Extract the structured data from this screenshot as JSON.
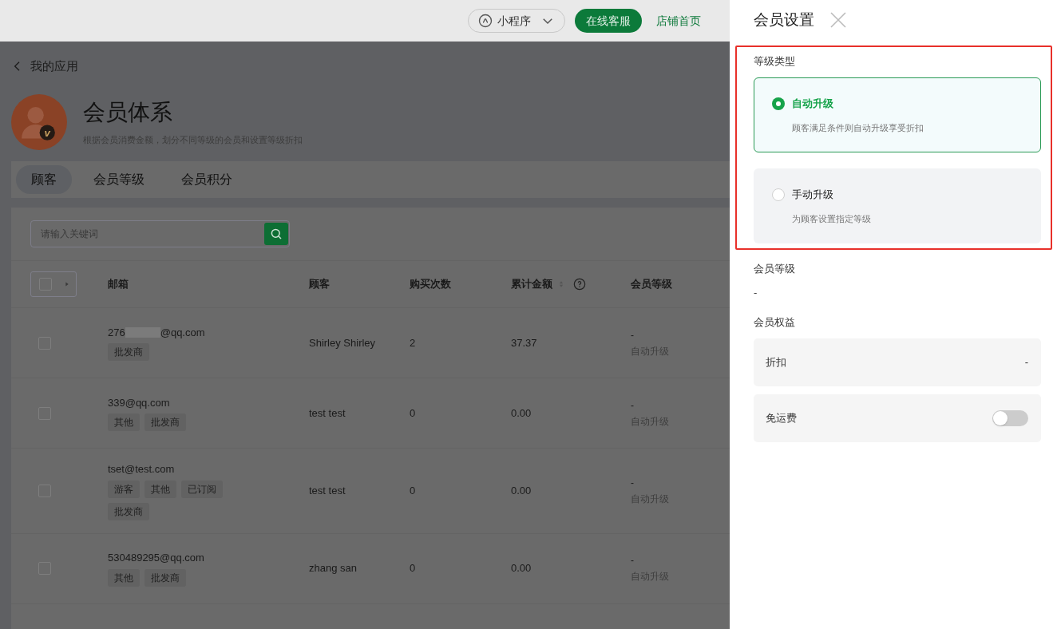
{
  "top_bar": {
    "mini_program": "小程序",
    "service_button": "在线客服",
    "store_link": "店铺首页"
  },
  "back_link": "我的应用",
  "app": {
    "logo_letter": "v",
    "title": "会员体系",
    "description": "根据会员消费金额，划分不同等级的会员和设置等级折扣"
  },
  "tabs": [
    {
      "label": "顾客",
      "selected": true
    },
    {
      "label": "会员等级",
      "selected": false
    },
    {
      "label": "会员积分",
      "selected": false
    }
  ],
  "search": {
    "placeholder": "请输入关键词"
  },
  "table": {
    "select_all_checked": false,
    "columns": [
      "邮箱",
      "顾客",
      "购买次数",
      "累计金额",
      "会员等级"
    ],
    "rows": [
      {
        "email_parts": [
          "276",
          "@qq.com"
        ],
        "tags": [
          "批发商"
        ],
        "customer": "Shirley Shirley",
        "purchases": "2",
        "total": "37.37",
        "level": "-",
        "upgrade": "自动升级",
        "checked": false
      },
      {
        "email_parts": [
          "339@qq.com"
        ],
        "tags": [
          "其他",
          "批发商"
        ],
        "customer": "test test",
        "purchases": "0",
        "total": "0.00",
        "level": "-",
        "upgrade": "自动升级",
        "checked": false
      },
      {
        "email_parts": [
          "tset@test.com"
        ],
        "tags": [
          "游客",
          "其他",
          "已订阅",
          "批发商"
        ],
        "customer": "test test",
        "purchases": "0",
        "total": "0.00",
        "level": "-",
        "upgrade": "自动升级",
        "checked": false
      },
      {
        "email_parts": [
          "530489295@qq.com"
        ],
        "tags": [
          "其他",
          "批发商"
        ],
        "customer": "zhang san",
        "purchases": "0",
        "total": "0.00",
        "level": "-",
        "upgrade": "自动升级",
        "checked": false
      }
    ]
  },
  "drawer": {
    "title": "会员设置",
    "level_type_label": "等级类型",
    "options": [
      {
        "title": "自动升级",
        "description": "顾客满足条件则自动升级享受折扣",
        "selected": true
      },
      {
        "title": "手动升级",
        "description": "为顾客设置指定等级",
        "selected": false
      }
    ],
    "member_level_label": "会员等级",
    "member_level": "-",
    "benefits_label": "会员权益",
    "benefits": [
      {
        "kind": "value",
        "label": "折扣",
        "value": "-"
      },
      {
        "kind": "toggle",
        "label": "免运费",
        "on": false
      }
    ]
  }
}
